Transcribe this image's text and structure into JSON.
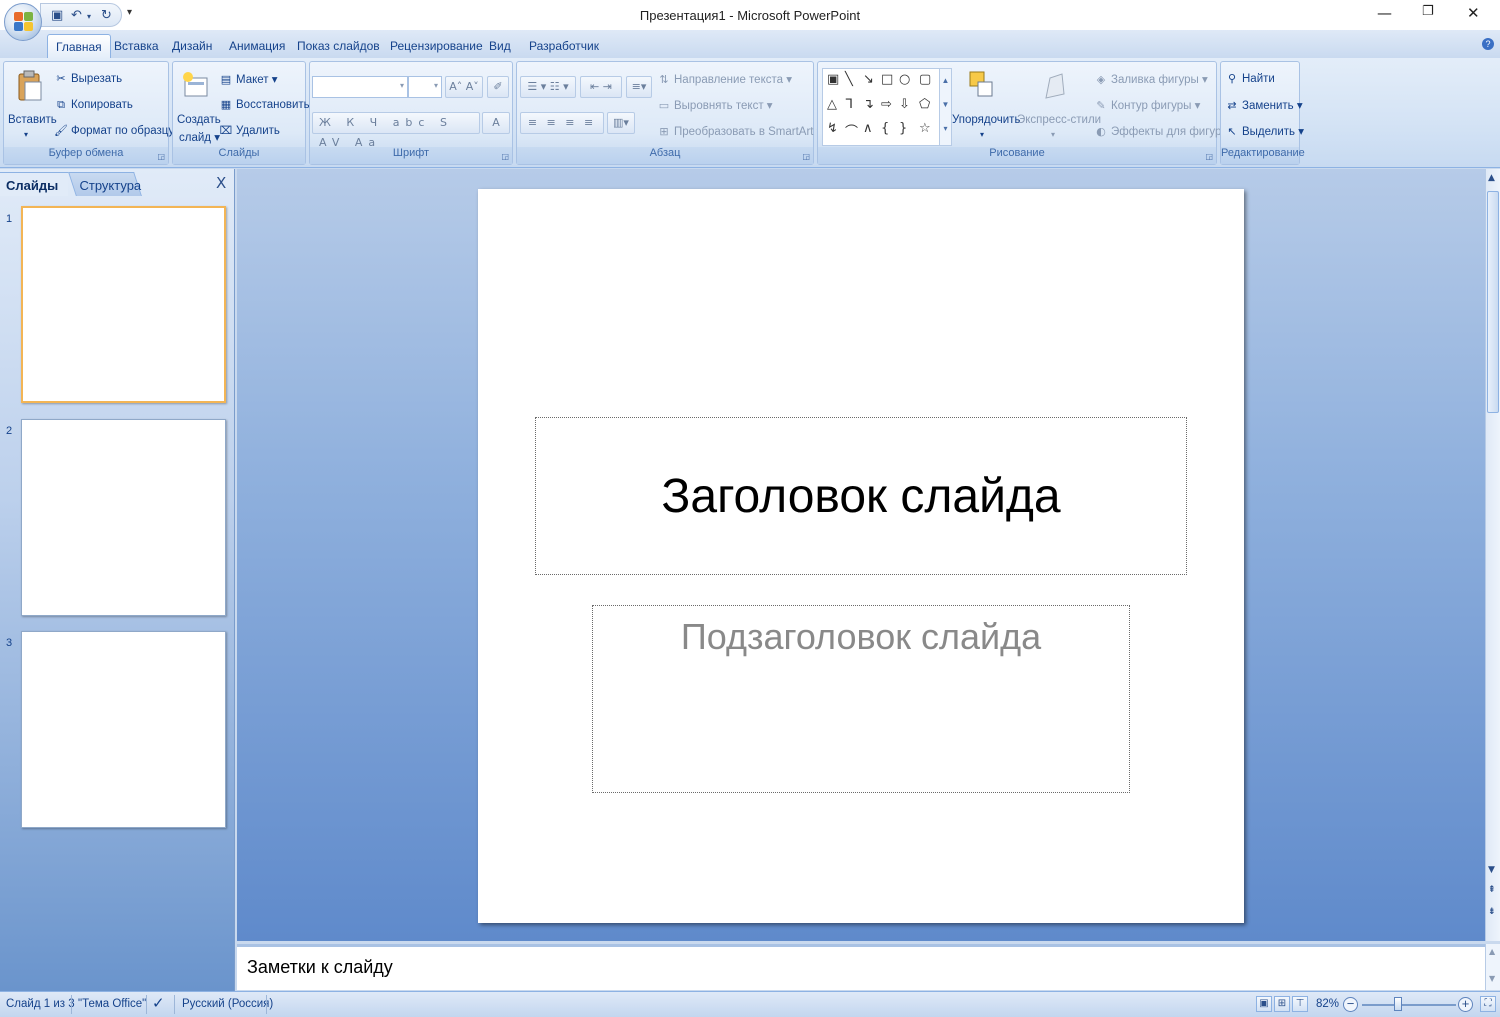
{
  "window": {
    "title": "Презентация1 - Microsoft PowerPoint"
  },
  "tabs": [
    "Главная",
    "Вставка",
    "Дизайн",
    "Анимация",
    "Показ слайдов",
    "Рецензирование",
    "Вид",
    "Разработчик"
  ],
  "ribbon": {
    "clipboard": {
      "label": "Буфер обмена",
      "paste": "Вставить",
      "cut": "Вырезать",
      "copy": "Копировать",
      "format_painter": "Формат по образцу"
    },
    "slides": {
      "label": "Слайды",
      "new_slide_line1": "Создать",
      "new_slide_line2": "слайд",
      "layout": "Макет",
      "reset": "Восстановить",
      "delete": "Удалить"
    },
    "font": {
      "label": "Шрифт",
      "font_name": "",
      "font_size": ""
    },
    "paragraph": {
      "label": "Абзац",
      "text_direction": "Направление текста",
      "align_text": "Выровнять текст",
      "convert_smartart": "Преобразовать в SmartArt"
    },
    "drawing": {
      "label": "Рисование",
      "arrange": "Упорядочить",
      "quick_styles": "Экспресс-стили",
      "shape_fill": "Заливка фигуры",
      "shape_outline": "Контур фигуры",
      "shape_effects": "Эффекты для фигур"
    },
    "editing": {
      "label": "Редактирование",
      "find": "Найти",
      "replace": "Заменить",
      "select": "Выделить"
    }
  },
  "left_panel": {
    "tab_slides": "Слайды",
    "tab_outline": "Структура",
    "close": "X",
    "slide_numbers": [
      "1",
      "2",
      "3"
    ]
  },
  "slide": {
    "title": "Заголовок слайда",
    "subtitle": "Подзаголовок слайда"
  },
  "notes": {
    "placeholder": "Заметки к слайду"
  },
  "status_bar": {
    "slide_info": "Слайд 1 из 3",
    "theme": "\"Тема Office\"",
    "language": "Русский (Россия)",
    "zoom": "82%"
  },
  "colors": {
    "accent": "#15428b",
    "ribbon_bg": "#dde9f7",
    "workspace": "#8fb0dd"
  }
}
